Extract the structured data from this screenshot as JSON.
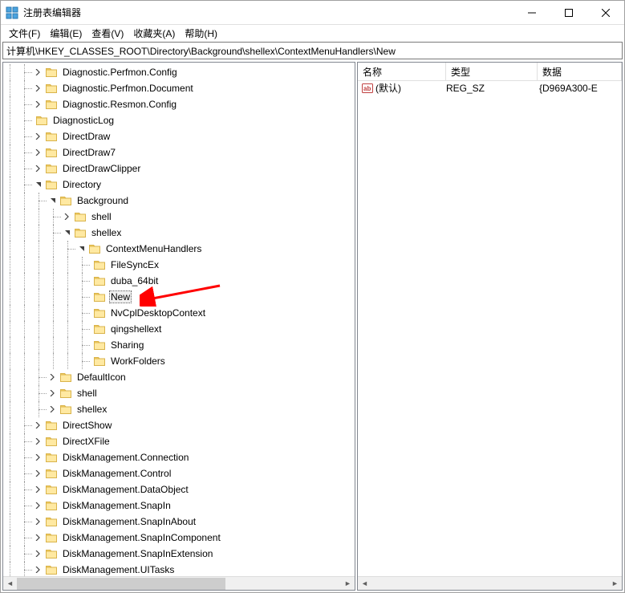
{
  "title": "注册表编辑器",
  "menu": {
    "file": "文件(F)",
    "edit": "编辑(E)",
    "view": "查看(V)",
    "favorites": "收藏夹(A)",
    "help": "帮助(H)"
  },
  "address": "计算机\\HKEY_CLASSES_ROOT\\Directory\\Background\\shellex\\ContextMenuHandlers\\New",
  "tree": [
    {
      "level": 2,
      "exp": ">",
      "label": "Diagnostic.Perfmon.Config"
    },
    {
      "level": 2,
      "exp": ">",
      "label": "Diagnostic.Perfmon.Document"
    },
    {
      "level": 2,
      "exp": ">",
      "label": "Diagnostic.Resmon.Config"
    },
    {
      "level": 2,
      "exp": "",
      "label": "DiagnosticLog"
    },
    {
      "level": 2,
      "exp": ">",
      "label": "DirectDraw"
    },
    {
      "level": 2,
      "exp": ">",
      "label": "DirectDraw7"
    },
    {
      "level": 2,
      "exp": ">",
      "label": "DirectDrawClipper"
    },
    {
      "level": 2,
      "exp": "v",
      "label": "Directory"
    },
    {
      "level": 3,
      "exp": "v",
      "label": "Background"
    },
    {
      "level": 4,
      "exp": ">",
      "label": "shell"
    },
    {
      "level": 4,
      "exp": "v",
      "label": "shellex"
    },
    {
      "level": 5,
      "exp": "v",
      "label": "ContextMenuHandlers"
    },
    {
      "level": 6,
      "exp": "",
      "label": " FileSyncEx"
    },
    {
      "level": 6,
      "exp": "",
      "label": "duba_64bit"
    },
    {
      "level": 6,
      "exp": "",
      "label": "New",
      "selected": true
    },
    {
      "level": 6,
      "exp": "",
      "label": "NvCplDesktopContext"
    },
    {
      "level": 6,
      "exp": "",
      "label": "qingshellext"
    },
    {
      "level": 6,
      "exp": "",
      "label": "Sharing"
    },
    {
      "level": 6,
      "exp": "",
      "label": "WorkFolders"
    },
    {
      "level": 3,
      "exp": ">",
      "label": "DefaultIcon"
    },
    {
      "level": 3,
      "exp": ">",
      "label": "shell"
    },
    {
      "level": 3,
      "exp": ">",
      "label": "shellex"
    },
    {
      "level": 2,
      "exp": ">",
      "label": "DirectShow"
    },
    {
      "level": 2,
      "exp": ">",
      "label": "DirectXFile"
    },
    {
      "level": 2,
      "exp": ">",
      "label": "DiskManagement.Connection"
    },
    {
      "level": 2,
      "exp": ">",
      "label": "DiskManagement.Control"
    },
    {
      "level": 2,
      "exp": ">",
      "label": "DiskManagement.DataObject"
    },
    {
      "level": 2,
      "exp": ">",
      "label": "DiskManagement.SnapIn"
    },
    {
      "level": 2,
      "exp": ">",
      "label": "DiskManagement.SnapInAbout"
    },
    {
      "level": 2,
      "exp": ">",
      "label": "DiskManagement.SnapInComponent"
    },
    {
      "level": 2,
      "exp": ">",
      "label": "DiskManagement.SnapInExtension"
    },
    {
      "level": 2,
      "exp": ">",
      "label": "DiskManagement.UITasks"
    }
  ],
  "columns": {
    "name": "名称",
    "type": "类型",
    "data": "数据"
  },
  "values": [
    {
      "name": "(默认)",
      "type": "REG_SZ",
      "data": "{D969A300-E"
    }
  ]
}
